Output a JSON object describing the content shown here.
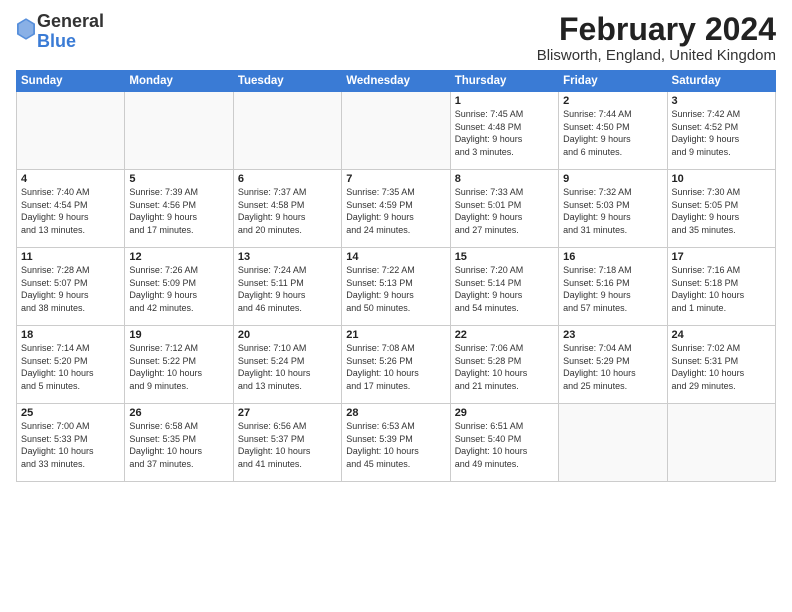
{
  "logo": {
    "general": "General",
    "blue": "Blue"
  },
  "title": {
    "month_year": "February 2024",
    "location": "Blisworth, England, United Kingdom"
  },
  "weekdays": [
    "Sunday",
    "Monday",
    "Tuesday",
    "Wednesday",
    "Thursday",
    "Friday",
    "Saturday"
  ],
  "weeks": [
    [
      {
        "day": "",
        "info": ""
      },
      {
        "day": "",
        "info": ""
      },
      {
        "day": "",
        "info": ""
      },
      {
        "day": "",
        "info": ""
      },
      {
        "day": "1",
        "info": "Sunrise: 7:45 AM\nSunset: 4:48 PM\nDaylight: 9 hours\nand 3 minutes."
      },
      {
        "day": "2",
        "info": "Sunrise: 7:44 AM\nSunset: 4:50 PM\nDaylight: 9 hours\nand 6 minutes."
      },
      {
        "day": "3",
        "info": "Sunrise: 7:42 AM\nSunset: 4:52 PM\nDaylight: 9 hours\nand 9 minutes."
      }
    ],
    [
      {
        "day": "4",
        "info": "Sunrise: 7:40 AM\nSunset: 4:54 PM\nDaylight: 9 hours\nand 13 minutes."
      },
      {
        "day": "5",
        "info": "Sunrise: 7:39 AM\nSunset: 4:56 PM\nDaylight: 9 hours\nand 17 minutes."
      },
      {
        "day": "6",
        "info": "Sunrise: 7:37 AM\nSunset: 4:58 PM\nDaylight: 9 hours\nand 20 minutes."
      },
      {
        "day": "7",
        "info": "Sunrise: 7:35 AM\nSunset: 4:59 PM\nDaylight: 9 hours\nand 24 minutes."
      },
      {
        "day": "8",
        "info": "Sunrise: 7:33 AM\nSunset: 5:01 PM\nDaylight: 9 hours\nand 27 minutes."
      },
      {
        "day": "9",
        "info": "Sunrise: 7:32 AM\nSunset: 5:03 PM\nDaylight: 9 hours\nand 31 minutes."
      },
      {
        "day": "10",
        "info": "Sunrise: 7:30 AM\nSunset: 5:05 PM\nDaylight: 9 hours\nand 35 minutes."
      }
    ],
    [
      {
        "day": "11",
        "info": "Sunrise: 7:28 AM\nSunset: 5:07 PM\nDaylight: 9 hours\nand 38 minutes."
      },
      {
        "day": "12",
        "info": "Sunrise: 7:26 AM\nSunset: 5:09 PM\nDaylight: 9 hours\nand 42 minutes."
      },
      {
        "day": "13",
        "info": "Sunrise: 7:24 AM\nSunset: 5:11 PM\nDaylight: 9 hours\nand 46 minutes."
      },
      {
        "day": "14",
        "info": "Sunrise: 7:22 AM\nSunset: 5:13 PM\nDaylight: 9 hours\nand 50 minutes."
      },
      {
        "day": "15",
        "info": "Sunrise: 7:20 AM\nSunset: 5:14 PM\nDaylight: 9 hours\nand 54 minutes."
      },
      {
        "day": "16",
        "info": "Sunrise: 7:18 AM\nSunset: 5:16 PM\nDaylight: 9 hours\nand 57 minutes."
      },
      {
        "day": "17",
        "info": "Sunrise: 7:16 AM\nSunset: 5:18 PM\nDaylight: 10 hours\nand 1 minute."
      }
    ],
    [
      {
        "day": "18",
        "info": "Sunrise: 7:14 AM\nSunset: 5:20 PM\nDaylight: 10 hours\nand 5 minutes."
      },
      {
        "day": "19",
        "info": "Sunrise: 7:12 AM\nSunset: 5:22 PM\nDaylight: 10 hours\nand 9 minutes."
      },
      {
        "day": "20",
        "info": "Sunrise: 7:10 AM\nSunset: 5:24 PM\nDaylight: 10 hours\nand 13 minutes."
      },
      {
        "day": "21",
        "info": "Sunrise: 7:08 AM\nSunset: 5:26 PM\nDaylight: 10 hours\nand 17 minutes."
      },
      {
        "day": "22",
        "info": "Sunrise: 7:06 AM\nSunset: 5:28 PM\nDaylight: 10 hours\nand 21 minutes."
      },
      {
        "day": "23",
        "info": "Sunrise: 7:04 AM\nSunset: 5:29 PM\nDaylight: 10 hours\nand 25 minutes."
      },
      {
        "day": "24",
        "info": "Sunrise: 7:02 AM\nSunset: 5:31 PM\nDaylight: 10 hours\nand 29 minutes."
      }
    ],
    [
      {
        "day": "25",
        "info": "Sunrise: 7:00 AM\nSunset: 5:33 PM\nDaylight: 10 hours\nand 33 minutes."
      },
      {
        "day": "26",
        "info": "Sunrise: 6:58 AM\nSunset: 5:35 PM\nDaylight: 10 hours\nand 37 minutes."
      },
      {
        "day": "27",
        "info": "Sunrise: 6:56 AM\nSunset: 5:37 PM\nDaylight: 10 hours\nand 41 minutes."
      },
      {
        "day": "28",
        "info": "Sunrise: 6:53 AM\nSunset: 5:39 PM\nDaylight: 10 hours\nand 45 minutes."
      },
      {
        "day": "29",
        "info": "Sunrise: 6:51 AM\nSunset: 5:40 PM\nDaylight: 10 hours\nand 49 minutes."
      },
      {
        "day": "",
        "info": ""
      },
      {
        "day": "",
        "info": ""
      }
    ]
  ]
}
